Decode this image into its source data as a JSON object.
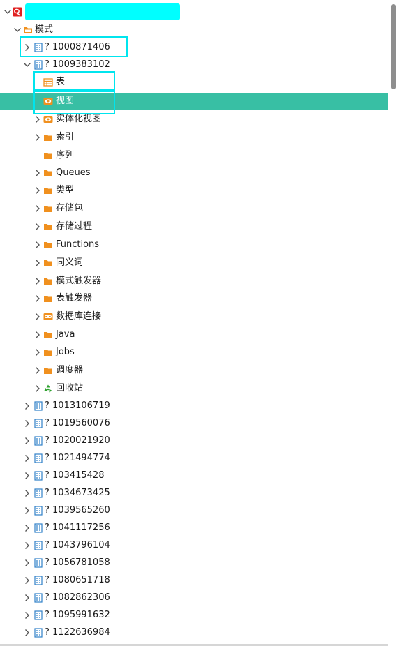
{
  "tree": {
    "root": {
      "label": ""
    },
    "schema_folder": {
      "label": "模式"
    },
    "schemas_top": [
      {
        "label": "? 1000871406",
        "expanded": false
      },
      {
        "label": "? 1009383102",
        "expanded": true
      }
    ],
    "children": [
      {
        "label": "表",
        "icon": "table-icon",
        "expandable": false
      },
      {
        "label": "视图",
        "icon": "view-icon",
        "expandable": false,
        "selected": true
      },
      {
        "label": "实体化视图",
        "icon": "view-icon",
        "expandable": true
      },
      {
        "label": "索引",
        "icon": "folder-icon",
        "expandable": true
      },
      {
        "label": "序列",
        "icon": "folder-icon",
        "expandable": false
      },
      {
        "label": "Queues",
        "icon": "folder-icon",
        "expandable": true
      },
      {
        "label": "类型",
        "icon": "folder-icon",
        "expandable": true
      },
      {
        "label": "存储包",
        "icon": "folder-icon",
        "expandable": true
      },
      {
        "label": "存储过程",
        "icon": "folder-icon",
        "expandable": true
      },
      {
        "label": "Functions",
        "icon": "folder-icon",
        "expandable": true
      },
      {
        "label": "同义词",
        "icon": "folder-icon",
        "expandable": true
      },
      {
        "label": "模式触发器",
        "icon": "folder-icon",
        "expandable": true
      },
      {
        "label": "表触发器",
        "icon": "folder-icon",
        "expandable": true
      },
      {
        "label": "数据库连接",
        "icon": "dblink-icon",
        "expandable": true
      },
      {
        "label": "Java",
        "icon": "folder-icon",
        "expandable": true
      },
      {
        "label": "Jobs",
        "icon": "folder-icon",
        "expandable": true
      },
      {
        "label": "调度器",
        "icon": "folder-icon",
        "expandable": true
      },
      {
        "label": "回收站",
        "icon": "recycle-icon",
        "expandable": true
      }
    ],
    "schemas_rest": [
      "? 1013106719",
      "? 1019560076",
      "? 1020021920",
      "? 1021494774",
      "? 103415428",
      "? 1034673425",
      "? 1039565260",
      "? 1041117256",
      "? 1043796104",
      "? 1056781058",
      "? 1080651718",
      "? 1082862306",
      "? 1095991632",
      "? 1122636984"
    ]
  },
  "colors": {
    "selection": "#38bfa4",
    "folder": "#f0901e",
    "schema_icon": "#2f80c8",
    "highlight_box": "#00e5ee",
    "recycle": "#2ca02c",
    "root_icon": "#e02020"
  }
}
